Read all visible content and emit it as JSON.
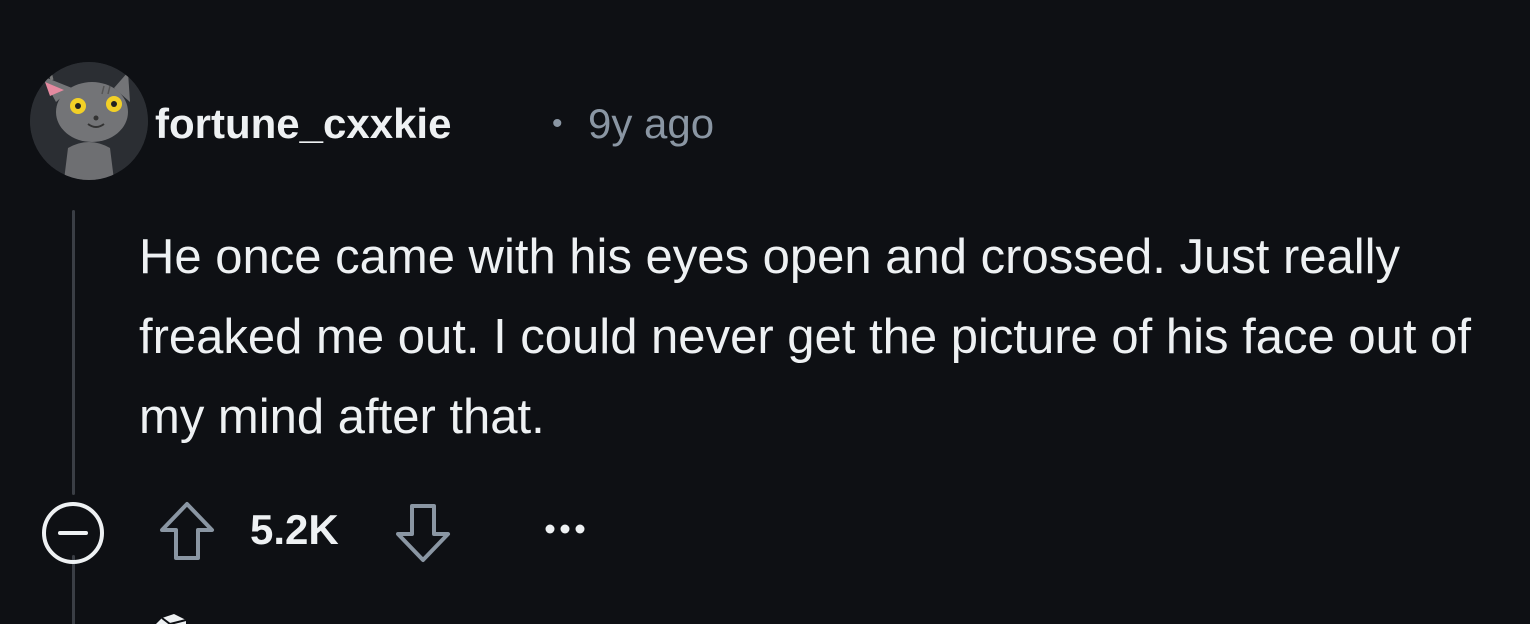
{
  "comment": {
    "author": "fortune_cxxkie",
    "separator": "•",
    "timestamp": "9y ago",
    "body": "He once came with his eyes open and crossed. Just really freaked me out. I could never get the picture of his face out of my mind after that.",
    "score": "5.2K"
  },
  "icons": {
    "avatar": "cat-snoo-avatar",
    "collapse": "collapse-minus-icon",
    "upvote": "upvote-arrow-icon",
    "downvote": "downvote-arrow-icon",
    "more": "more-options-icon"
  },
  "colors": {
    "background": "#0e1014",
    "text_primary": "#eef1f3",
    "text_secondary": "#8a96a3",
    "thread_line": "#3a3e45"
  }
}
